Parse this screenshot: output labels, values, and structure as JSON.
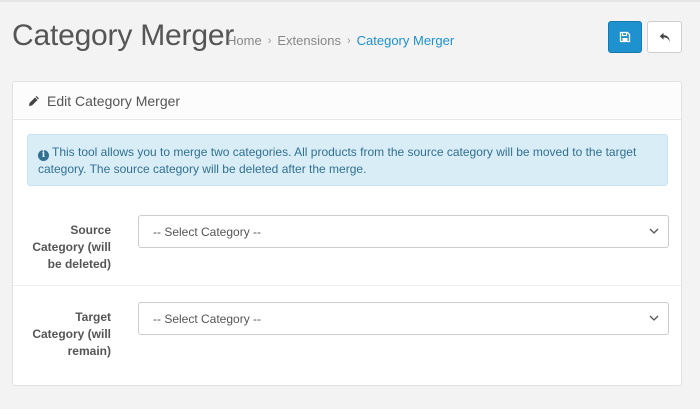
{
  "header": {
    "title": "Category Merger",
    "breadcrumb": [
      "Home",
      "Extensions",
      "Category Merger"
    ],
    "save_icon": "save-icon",
    "back_icon": "reply-icon"
  },
  "panel": {
    "title": "Edit Category Merger",
    "icon": "pencil-icon",
    "alert_text": "This tool allows you to merge two categories. All products from the source category will be moved to the target category. The source category will be deleted after the merge."
  },
  "form": {
    "source": {
      "label": "Source Category (will be deleted)",
      "selected": "-- Select Category --"
    },
    "target": {
      "label": "Target Category (will remain)",
      "selected": "-- Select Category --"
    }
  },
  "colors": {
    "primary": "#1e91cf",
    "alert_bg": "#d9edf7",
    "alert_text": "#31708f"
  }
}
